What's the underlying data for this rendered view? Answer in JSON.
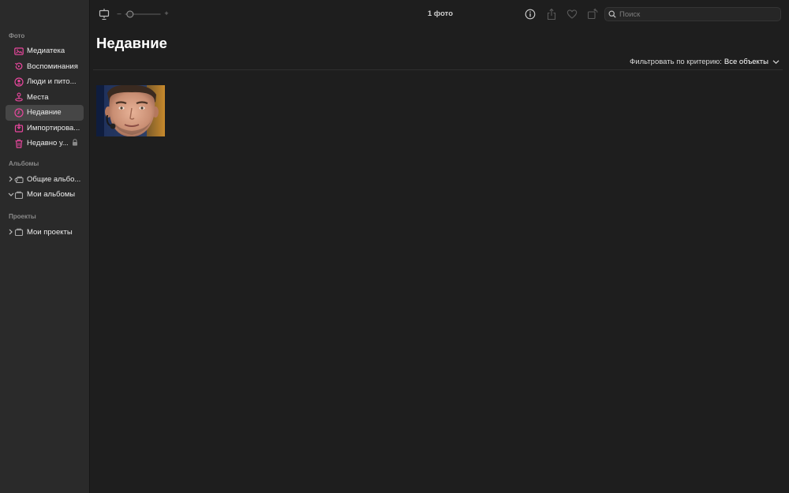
{
  "sidebar": {
    "photos_title": "Фото",
    "items": [
      {
        "label": "Медиатека",
        "icon": "library-icon"
      },
      {
        "label": "Воспоминания",
        "icon": "memories-icon"
      },
      {
        "label": "Люди и пито...",
        "icon": "people-icon"
      },
      {
        "label": "Места",
        "icon": "places-icon"
      },
      {
        "label": "Недавние",
        "icon": "recents-icon",
        "active": true
      },
      {
        "label": "Импортирова...",
        "icon": "imports-icon"
      },
      {
        "label": "Недавно у...",
        "icon": "trash-icon",
        "locked": true
      }
    ],
    "albums_title": "Альбомы",
    "albums": [
      {
        "label": "Общие альбо...",
        "icon": "shared-albums-icon",
        "expanded": false
      },
      {
        "label": "Мои альбомы",
        "icon": "folder-icon",
        "expanded": true
      }
    ],
    "projects_title": "Проекты",
    "projects": [
      {
        "label": "Мои проекты",
        "icon": "folder-icon",
        "expanded": false
      }
    ]
  },
  "toolbar": {
    "zoom_minus": "–",
    "zoom_plus": "+",
    "zoom_level": 0.05,
    "photo_count": "1 фото",
    "search_placeholder": "Поиск"
  },
  "main": {
    "title": "Недавние",
    "filter_label": "Фильтровать по критерию:",
    "filter_value": "Все объекты"
  },
  "colors": {
    "accent": "#e8479d",
    "sidebar_bg": "#2a2a2a",
    "content_bg": "#1e1e1e",
    "active_item_bg": "#464646"
  }
}
